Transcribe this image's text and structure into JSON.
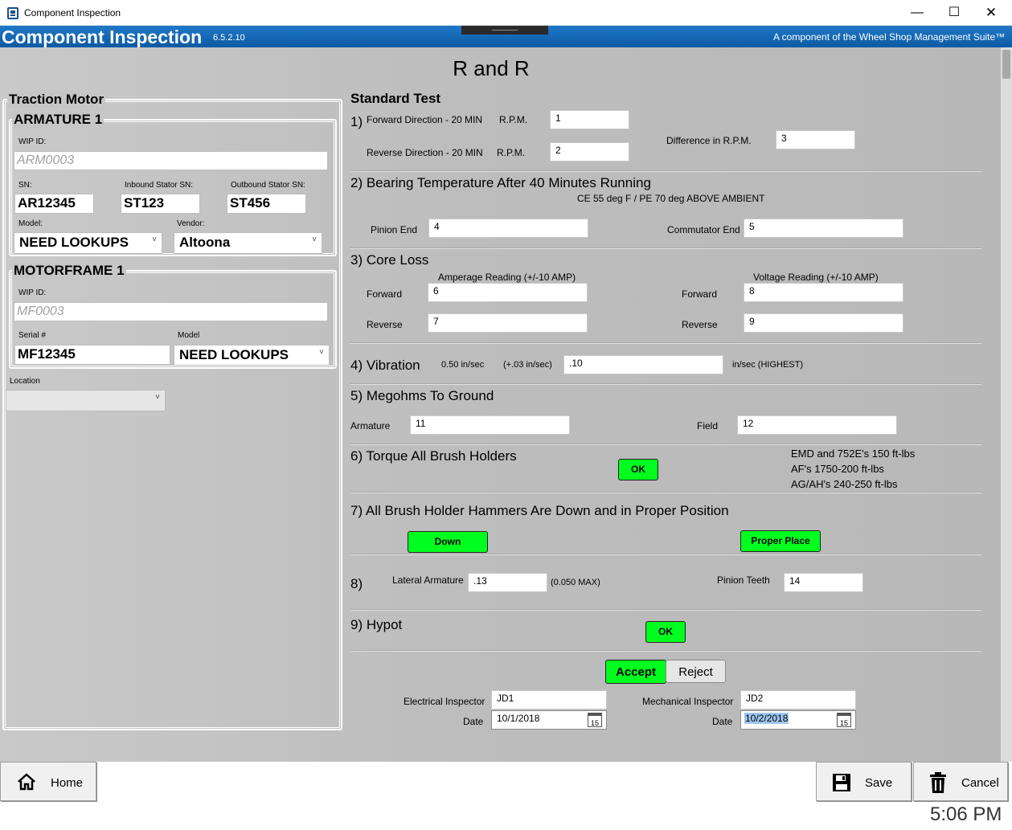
{
  "window": {
    "title": "Component Inspection",
    "minimize": "—",
    "maximize": "☐",
    "close": "✕"
  },
  "header": {
    "app_title": "Component Inspection",
    "version": "6.5.2.10",
    "tagline": "A component of the Wheel Shop Management Suite™",
    "brand_color": "#1166b3"
  },
  "page": {
    "title": "R and R"
  },
  "traction_motor": {
    "title": "Traction Motor",
    "armature": {
      "title": "ARMATURE 1",
      "wip_label": "WIP ID:",
      "wip_value": "ARM0003",
      "sn_label": "SN:",
      "sn_value": "AR12345",
      "inbound_label": "Inbound Stator SN:",
      "inbound_value": "ST123",
      "outbound_label": "Outbound Stator SN:",
      "outbound_value": "ST456",
      "model_label": "Model:",
      "model_value": "NEED LOOKUPS",
      "vendor_label": "Vendor:",
      "vendor_value": "Altoona"
    },
    "motorframe": {
      "title": "MOTORFRAME 1",
      "wip_label": "WIP ID:",
      "wip_value": "MF0003",
      "serial_label": "Serial #",
      "serial_value": "MF12345",
      "model_label": "Model",
      "model_value": "NEED LOOKUPS"
    },
    "location_label": "Location",
    "location_value": ""
  },
  "standard_test": {
    "title": "Standard Test",
    "s1": {
      "num": "1)",
      "forward_label": "Forward Direction - 20 MIN",
      "reverse_label": "Reverse Direction - 20 MIN",
      "rpm_label": "R.P.M.",
      "forward_value": "1",
      "reverse_value": "2",
      "diff_label": "Difference in R.P.M.",
      "diff_value": "3"
    },
    "s2": {
      "title": "2) Bearing Temperature After 40 Minutes Running",
      "note": "CE 55 deg F / PE 70 deg ABOVE AMBIENT",
      "pinion_label": "Pinion End",
      "pinion_value": "4",
      "commutator_label": "Commutator End",
      "commutator_value": "5"
    },
    "s3": {
      "title": "3) Core Loss",
      "amp_label": "Amperage Reading (+/-10 AMP)",
      "volt_label": "Voltage Reading (+/-10 AMP)",
      "forward_label": "Forward",
      "reverse_label": "Reverse",
      "amp_forward": "6",
      "amp_reverse": "7",
      "volt_forward": "8",
      "volt_reverse": "9"
    },
    "s4": {
      "title": "4) Vibration",
      "spec": "0.50 in/sec",
      "tolerance": "(+.03 in/sec)",
      "value": ".10",
      "unit": "in/sec (HIGHEST)"
    },
    "s5": {
      "title": "5) Megohms To Ground",
      "armature_label": "Armature",
      "armature_value": "11",
      "field_label": "Field",
      "field_value": "12"
    },
    "s6": {
      "title": "6) Torque All Brush Holders",
      "button": "OK",
      "notes": [
        "EMD and 752E's 150 ft-lbs",
        "AF's 1750-200 ft-lbs",
        "AG/AH's 240-250 ft-lbs"
      ]
    },
    "s7": {
      "title": "7) All Brush Holder Hammers Are Down and in Proper Position",
      "down_button": "Down",
      "proper_button": "Proper Place"
    },
    "s8": {
      "num": "8)",
      "lateral_label": "Lateral Armature",
      "lateral_value": ".13",
      "lateral_max": "(0.050 MAX)",
      "pinion_label": "Pinion Teeth",
      "pinion_value": "14"
    },
    "s9": {
      "title": "9) Hypot",
      "button": "OK"
    },
    "decision": {
      "accept": "Accept",
      "reject": "Reject",
      "accept_color": "#00ff1e"
    },
    "inspectors": {
      "electrical_label": "Electrical Inspector",
      "electrical_value": "JD1",
      "mechanical_label": "Mechanical Inspector",
      "mechanical_value": "JD2",
      "date_label": "Date",
      "electrical_date": "10/1/2018",
      "mechanical_date": "10/2/2018",
      "calendar_day": "15"
    }
  },
  "bottom": {
    "home": "Home",
    "save": "Save",
    "cancel": "Cancel",
    "clock": "5:06 PM"
  }
}
